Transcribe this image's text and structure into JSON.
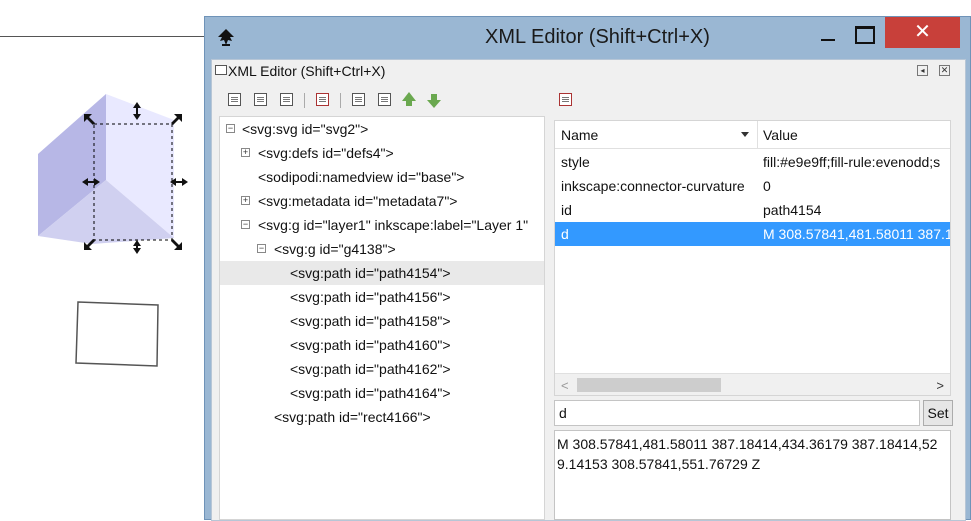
{
  "window": {
    "title": "XML Editor (Shift+Ctrl+X)",
    "close_glyph": "✕"
  },
  "panel": {
    "header": "XML Editor (Shift+Ctrl+X)"
  },
  "toolbar_left": {
    "buttons": [
      "new-element-node-icon",
      "new-text-node-icon",
      "duplicate-node-icon",
      "delete-node-icon",
      "unindent-node-icon",
      "indent-node-icon",
      "raise-node-icon",
      "lower-node-icon"
    ]
  },
  "toolbar_right": {
    "buttons": [
      "delete-attribute-icon"
    ]
  },
  "tree": {
    "nodes": [
      {
        "label": "<svg:svg id=\"svg2\">",
        "expander": "⊟"
      },
      {
        "label": "<svg:defs id=\"defs4\">",
        "expander": "⊞"
      },
      {
        "label": "<sodipodi:namedview id=\"base\">",
        "expander": ""
      },
      {
        "label": "<svg:metadata id=\"metadata7\">",
        "expander": "⊞"
      },
      {
        "label": "<svg:g id=\"layer1\" inkscape:label=\"Layer 1\"",
        "expander": "⊟"
      },
      {
        "label": "<svg:g id=\"g4138\">",
        "expander": "⊟"
      },
      {
        "label": "<svg:path id=\"path4154\">",
        "expander": ""
      },
      {
        "label": "<svg:path id=\"path4156\">",
        "expander": ""
      },
      {
        "label": "<svg:path id=\"path4158\">",
        "expander": ""
      },
      {
        "label": "<svg:path id=\"path4160\">",
        "expander": ""
      },
      {
        "label": "<svg:path id=\"path4162\">",
        "expander": ""
      },
      {
        "label": "<svg:path id=\"path4164\">",
        "expander": ""
      },
      {
        "label": "<svg:path id=\"rect4166\">",
        "expander": ""
      }
    ]
  },
  "attributes": {
    "col_name": "Name",
    "col_value": "Value",
    "rows": [
      {
        "name": "style",
        "value": "fill:#e9e9ff;fill-rule:evenodd;s"
      },
      {
        "name": "inkscape:connector-curvature",
        "value": "0"
      },
      {
        "name": "id",
        "value": "path4154"
      },
      {
        "name": "d",
        "value": "M 308.57841,481.58011 387.1"
      }
    ],
    "scroll_left": "<",
    "scroll_right": ">"
  },
  "editor": {
    "attr_name": "d",
    "set_label": "Set",
    "attr_value": "M 308.57841,481.58011 387.18414,434.36179 387.18414,529.14153 308.57841,551.76729 Z"
  }
}
